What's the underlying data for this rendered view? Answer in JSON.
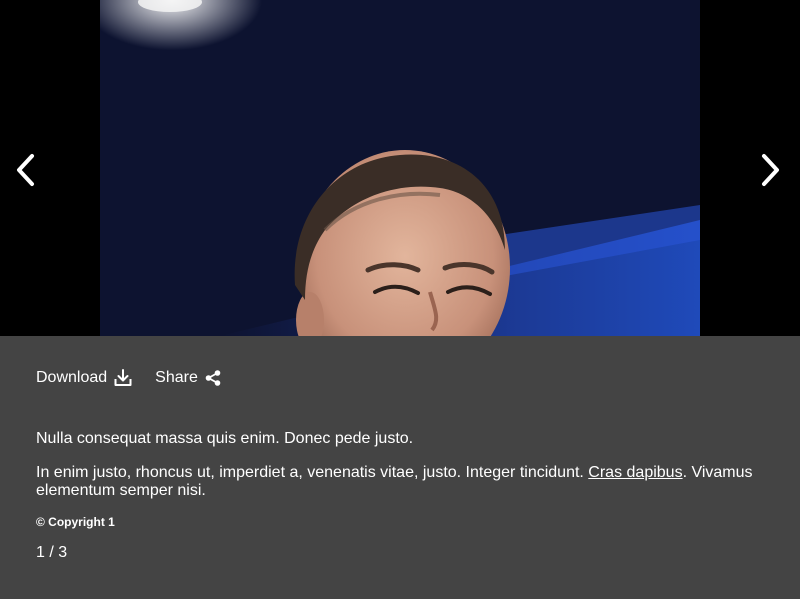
{
  "gallery": {
    "prev_icon": "chevron-left-icon",
    "next_icon": "chevron-right-icon"
  },
  "actions": {
    "download_label": "Download",
    "download_icon": "download-icon",
    "share_label": "Share",
    "share_icon": "share-icon"
  },
  "caption": {
    "line1": "Nulla consequat massa quis enim. Donec pede justo.",
    "line2_before": "In enim justo, rhoncus ut, imperdiet a, venenatis vitae, justo. Integer tincidunt. ",
    "line2_link": "Cras dapibus",
    "line2_after": ". Vivamus elementum semper nisi."
  },
  "copyright": "© Copyright 1",
  "counter": "1 / 3",
  "colors": {
    "panel": "#444444",
    "text": "#ffffff",
    "background": "#000000"
  }
}
